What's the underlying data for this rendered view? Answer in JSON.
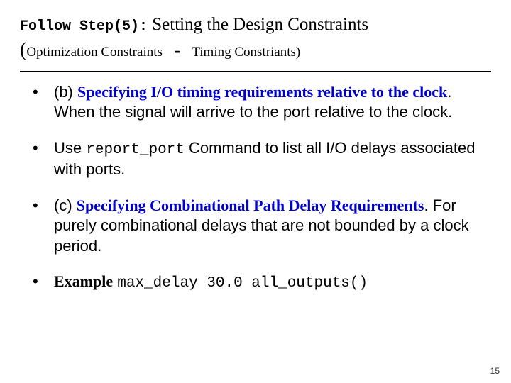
{
  "title": {
    "prefix_mono": "Follow Step(5):",
    "main_serif": " Setting the Design Constraints",
    "paren_open": "(",
    "sub_small": "Optimization Constraints",
    "dash_mono": " - ",
    "sub_small2": "Timing Constriants)"
  },
  "bullets": [
    {
      "lead": "(b) ",
      "blue_serif": "Specifying I/O timing requirements relative to the clock",
      "rest": ". When the signal will arrive to the port relative to the clock."
    },
    {
      "lead": "Use ",
      "code": "report_port",
      "rest": " Command to list all I/O delays associated with ports."
    },
    {
      "lead": "(c) ",
      "blue_serif": "Specifying Combinational Path Delay Requirements",
      "rest": ". For purely combinational delays that are not bounded by a clock period."
    },
    {
      "bold_serif": "Example",
      "space": " ",
      "code": "max_delay 30.0 all_outputs()"
    }
  ],
  "page_number": "15"
}
